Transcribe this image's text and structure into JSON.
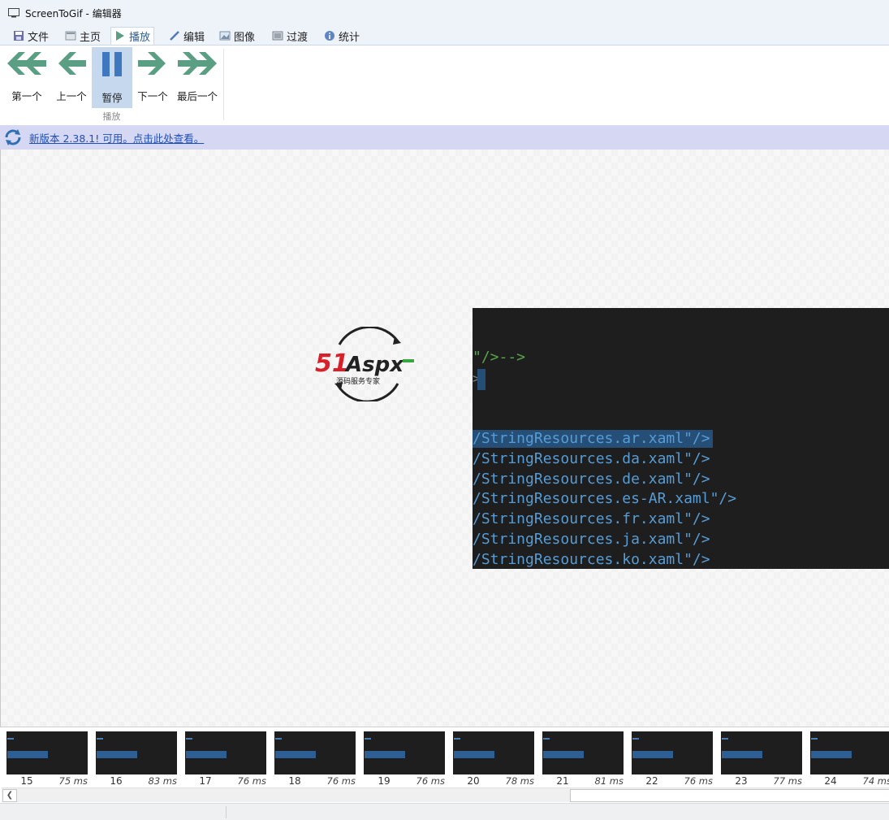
{
  "window": {
    "title": "ScreenToGif - 编辑器"
  },
  "tabs": [
    {
      "label": "文件",
      "icon": "save-icon"
    },
    {
      "label": "主页",
      "icon": "home-icon"
    },
    {
      "label": "播放",
      "icon": "play-icon",
      "active": true
    },
    {
      "label": "编辑",
      "icon": "pencil-icon"
    },
    {
      "label": "图像",
      "icon": "image-icon"
    },
    {
      "label": "过渡",
      "icon": "transition-icon"
    },
    {
      "label": "统计",
      "icon": "info-icon"
    }
  ],
  "ribbon": {
    "first_label": "第一个",
    "previous_label": "上一个",
    "pause_label": "暂停",
    "next_label": "下一个",
    "last_label": "最后一个",
    "group_label": "播放"
  },
  "update_bar": {
    "text": "新版本 2.38.1! 可用。点击此处查看。"
  },
  "preview": {
    "logo_text": "51Aspx",
    "logo_subtitle": "源码服务专家",
    "code_lines": [
      "\"/>-->",
      "/StringResources.ar.xaml\"/>",
      "/StringResources.da.xaml\"/>",
      "/StringResources.de.xaml\"/>",
      "/StringResources.es-AR.xaml\"/>",
      "/StringResources.fr.xaml\"/>",
      "/StringResources.ja.xaml\"/>",
      "/StringResources.ko.xaml\"/>"
    ]
  },
  "timeline": {
    "frames": [
      {
        "number": "15",
        "delay": "75 ms"
      },
      {
        "number": "16",
        "delay": "83 ms"
      },
      {
        "number": "17",
        "delay": "76 ms"
      },
      {
        "number": "18",
        "delay": "76 ms"
      },
      {
        "number": "19",
        "delay": "76 ms"
      },
      {
        "number": "20",
        "delay": "78 ms"
      },
      {
        "number": "21",
        "delay": "81 ms"
      },
      {
        "number": "22",
        "delay": "76 ms"
      },
      {
        "number": "23",
        "delay": "77 ms"
      },
      {
        "number": "24",
        "delay": "74 ms"
      }
    ]
  },
  "colors": {
    "accent": "#5a9e84",
    "update_bar": "#d5d7f3",
    "link": "#1c4fbd",
    "code_bg": "#1e1e1e"
  }
}
